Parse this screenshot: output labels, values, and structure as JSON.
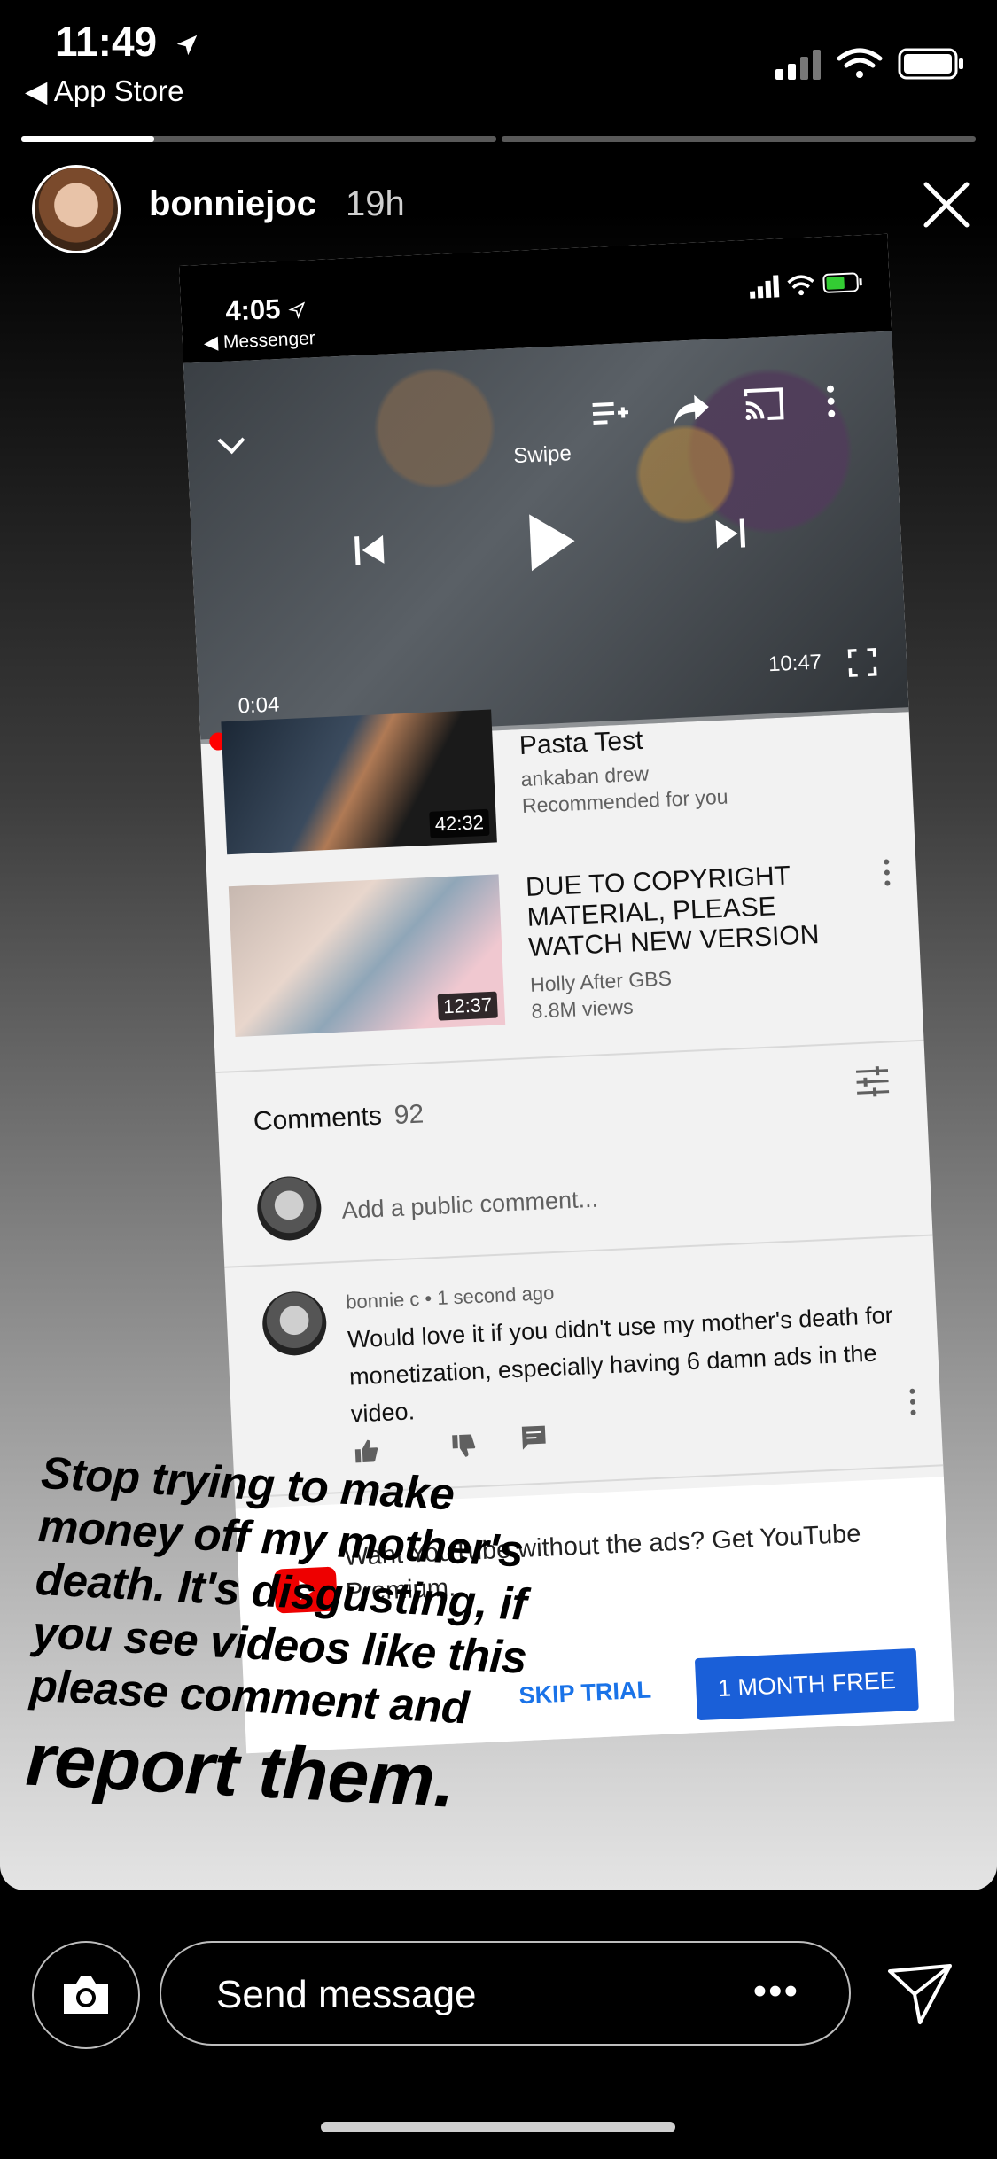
{
  "status_bar": {
    "time": "11:49",
    "back_label": "◀ App Store"
  },
  "story": {
    "username": "bonniejoc",
    "time_ago": "19h",
    "progress_segments": [
      0.28,
      0
    ]
  },
  "screenshot": {
    "status": {
      "time": "4:05",
      "back_label": "◀ Messenger"
    },
    "player": {
      "swipe_label": "Swipe",
      "elapsed": "0:04",
      "total": "10:47"
    },
    "videos": [
      {
        "title": "Pasta Test",
        "channel": "ankaban drew",
        "meta": "Recommended for you",
        "duration": "42:32"
      },
      {
        "title": "DUE TO COPYRIGHT MATERIAL, PLEASE WATCH NEW VERSION",
        "channel": "Holly After GBS",
        "meta": "8.8M views",
        "duration": "12:37"
      }
    ],
    "comments": {
      "label": "Comments",
      "count": "92",
      "add_placeholder": "Add a public comment...",
      "items": [
        {
          "meta": "bonnie c • 1 second ago",
          "text": "Would love it if you didn't use my mother's death for monetization, especially having 6 damn ads in the video."
        }
      ]
    },
    "promo": {
      "text": "Want YouTube without the ads? Get YouTube Premium.",
      "skip_label": "SKIP TRIAL",
      "cta_label": "1 MONTH FREE"
    }
  },
  "overlay_text": {
    "lines": [
      "Stop trying to make",
      "money off my mother's",
      "death. It's disgusting, if",
      "you see videos like this",
      "please comment and"
    ],
    "big_line": "report them."
  },
  "bottom_bar": {
    "message_placeholder": "Send message",
    "more_label": "•••"
  },
  "colors": {
    "accent_blue": "#1a5fd8",
    "link_blue": "#1a73e8",
    "youtube_red": "#e00000"
  },
  "icons": [
    "location-arrow-icon",
    "signal-icon",
    "wifi-icon",
    "battery-icon",
    "close-icon",
    "camera-icon",
    "send-icon",
    "chevron-down-icon",
    "add-queue-icon",
    "share-icon",
    "cast-icon",
    "more-vert-icon",
    "skip-previous-icon",
    "play-icon",
    "skip-next-icon",
    "fullscreen-icon",
    "filter-icon",
    "like-icon",
    "dislike-icon",
    "reply-icon",
    "youtube-icon"
  ]
}
